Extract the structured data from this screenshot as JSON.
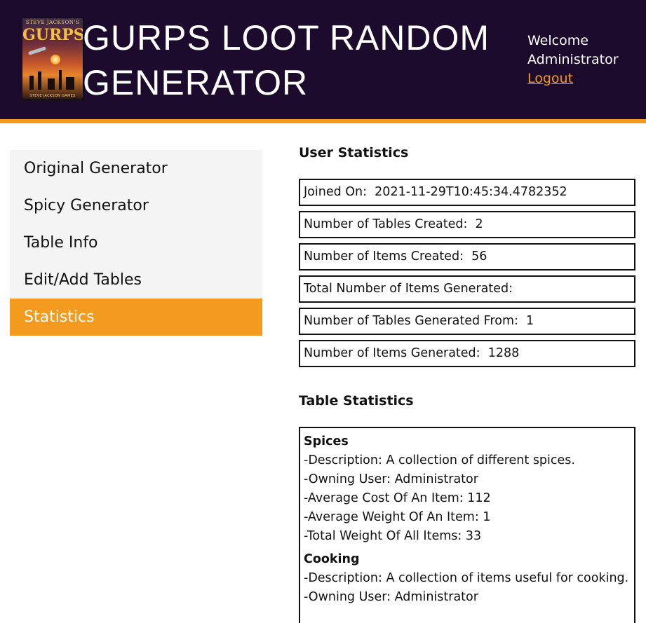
{
  "header": {
    "logo": {
      "top_text": "STEVE JACKSON'S",
      "title": "GURPS",
      "bottom_text": "STEVE JACKSON GAMES"
    },
    "title": "GURPS LOOT RANDOM GENERATOR",
    "welcome_label": "Welcome",
    "username": "Administrator",
    "logout_label": "Logout"
  },
  "nav": {
    "items": [
      {
        "label": "Original Generator"
      },
      {
        "label": "Spicy Generator"
      },
      {
        "label": "Table Info"
      },
      {
        "label": "Edit/Add Tables"
      },
      {
        "label": "Statistics"
      }
    ]
  },
  "user_stats": {
    "heading": "User Statistics",
    "rows": [
      {
        "label": "Joined On:",
        "value": "2021-11-29T10:45:34.4782352"
      },
      {
        "label": "Number of Tables Created:",
        "value": "2"
      },
      {
        "label": "Number of Items Created:",
        "value": "56"
      },
      {
        "label": "Total Number of Items Generated:",
        "value": ""
      },
      {
        "label": "Number of Tables Generated From:",
        "value": "1"
      },
      {
        "label": "Number of Items Generated:",
        "value": "1288"
      }
    ]
  },
  "table_stats": {
    "heading": "Table Statistics",
    "tables": [
      {
        "name": "Spices",
        "lines": [
          "-Description: A collection of different spices.",
          "-Owning User: Administrator",
          "-Average Cost Of An Item: 112",
          "-Average Weight Of An Item: 1",
          "-Total Weight Of All Items: 33"
        ]
      },
      {
        "name": "Cooking",
        "lines": [
          "-Description: A collection of items useful for cooking.",
          "-Owning User: Administrator"
        ]
      }
    ]
  },
  "colors": {
    "header_bg": "#1c0b2c",
    "accent": "#f49a1f",
    "sidebar_bg": "#f4f4f4"
  }
}
